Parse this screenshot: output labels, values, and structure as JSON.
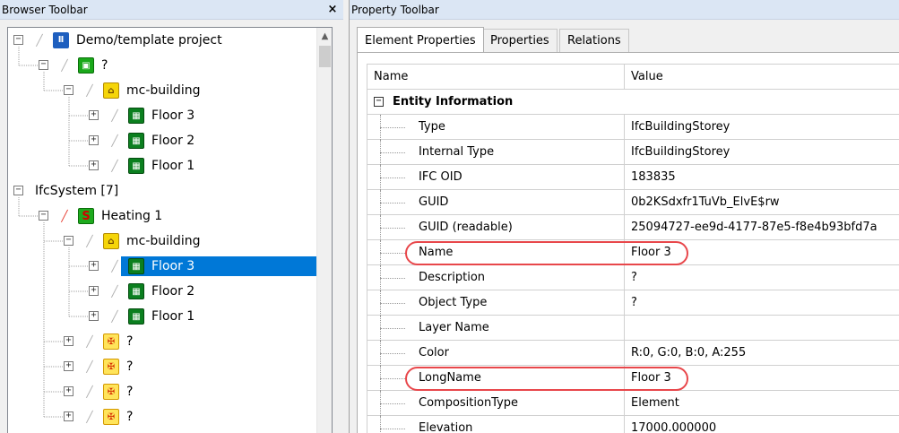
{
  "left_panel": {
    "title": "Browser Toolbar",
    "close_label": "×",
    "tree": [
      {
        "label": "Demo/template project",
        "icon": "project-icon",
        "expander": "−",
        "level": 0,
        "pencil": "gray"
      },
      {
        "label": "?",
        "icon": "site-icon",
        "expander": "−",
        "level": 1,
        "pencil": "gray"
      },
      {
        "label": "mc-building",
        "icon": "building-icon",
        "expander": "−",
        "level": 2,
        "pencil": "gray"
      },
      {
        "label": "Floor 3",
        "icon": "storey-icon",
        "expander": "+",
        "level": 3,
        "pencil": "gray"
      },
      {
        "label": "Floor 2",
        "icon": "storey-icon",
        "expander": "+",
        "level": 3,
        "pencil": "gray"
      },
      {
        "label": "Floor 1",
        "icon": "storey-icon",
        "expander": "+",
        "level": 3,
        "pencil": "gray"
      },
      {
        "label": "IfcSystem [7]",
        "icon": "",
        "expander": "−",
        "level": 0,
        "pencil": "none"
      },
      {
        "label": "Heating 1",
        "icon": "system-icon",
        "expander": "−",
        "level": 1,
        "pencil": "red"
      },
      {
        "label": "mc-building",
        "icon": "building-icon",
        "expander": "−",
        "level": 2,
        "pencil": "gray"
      },
      {
        "label": "Floor 3",
        "icon": "storey-icon",
        "expander": "+",
        "level": 3,
        "pencil": "gray",
        "selected": true
      },
      {
        "label": "Floor 2",
        "icon": "storey-icon",
        "expander": "+",
        "level": 3,
        "pencil": "gray"
      },
      {
        "label": "Floor 1",
        "icon": "storey-icon",
        "expander": "+",
        "level": 3,
        "pencil": "gray"
      },
      {
        "label": "?",
        "icon": "proxy-icon",
        "expander": "+",
        "level": 2,
        "pencil": "gray"
      },
      {
        "label": "?",
        "icon": "proxy-icon",
        "expander": "+",
        "level": 2,
        "pencil": "gray"
      },
      {
        "label": "?",
        "icon": "proxy-icon",
        "expander": "+",
        "level": 2,
        "pencil": "gray"
      },
      {
        "label": "?",
        "icon": "proxy-icon",
        "expander": "+",
        "level": 2,
        "pencil": "gray"
      }
    ]
  },
  "right_panel": {
    "title": "Property Toolbar",
    "tabs": [
      {
        "label": "Element Properties",
        "active": true
      },
      {
        "label": "Properties",
        "active": false
      },
      {
        "label": "Relations",
        "active": false
      }
    ],
    "grid": {
      "header_name": "Name",
      "header_value": "Value",
      "category": {
        "label": "Entity Information",
        "toggle": "−"
      },
      "rows": [
        {
          "name": "Type",
          "value": "IfcBuildingStorey"
        },
        {
          "name": "Internal Type",
          "value": "IfcBuildingStorey"
        },
        {
          "name": "IFC OID",
          "value": "183835"
        },
        {
          "name": "GUID",
          "value": "0b2KSdxfr1TuVb_ElvE$rw"
        },
        {
          "name": "GUID (readable)",
          "value": "25094727-ee9d-4177-87e5-f8e4b93bfd7a"
        },
        {
          "name": "Name",
          "value": "Floor 3",
          "highlight": true
        },
        {
          "name": "Description",
          "value": "?"
        },
        {
          "name": "Object Type",
          "value": "?"
        },
        {
          "name": "Layer Name",
          "value": ""
        },
        {
          "name": "Color",
          "value": "R:0, G:0, B:0, A:255"
        },
        {
          "name": "LongName",
          "value": "Floor 3",
          "highlight": true
        },
        {
          "name": "CompositionType",
          "value": "Element"
        },
        {
          "name": "Elevation",
          "value": "17000.000000"
        }
      ]
    }
  }
}
